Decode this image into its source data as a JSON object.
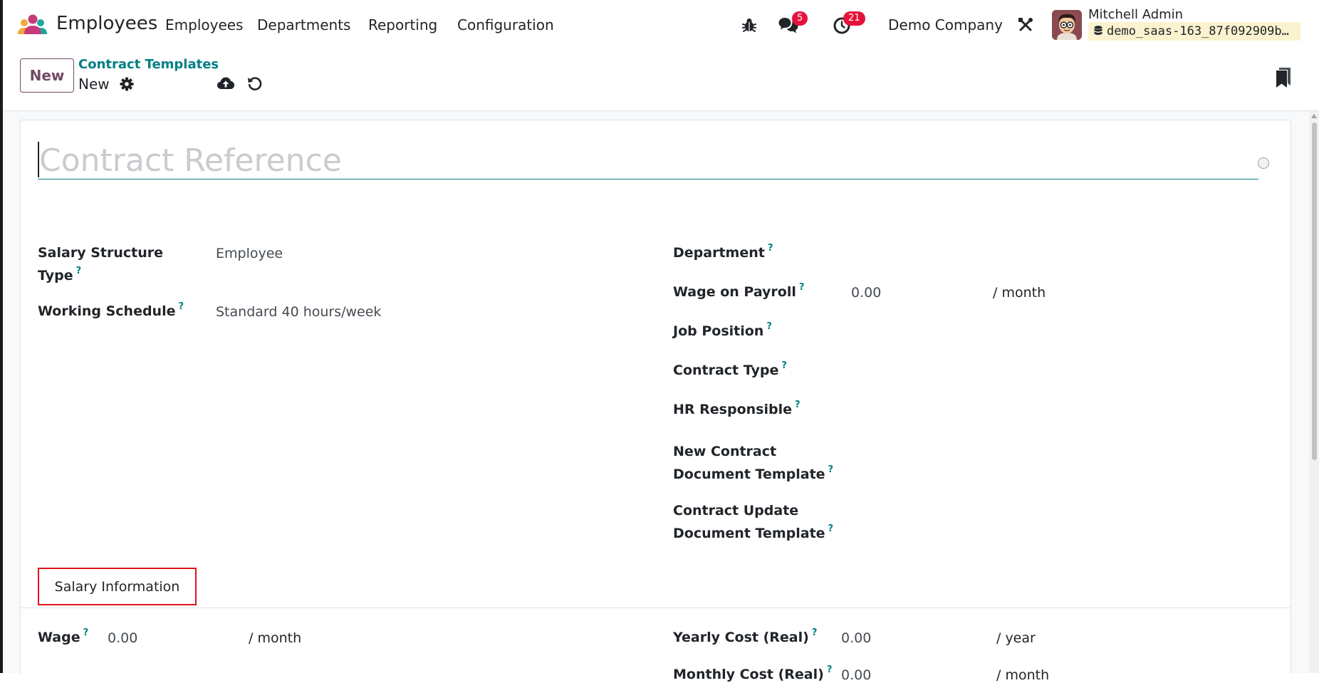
{
  "navbar": {
    "app_name": "Employees",
    "menus": [
      "Employees",
      "Departments",
      "Reporting",
      "Configuration"
    ],
    "messages_count": "5",
    "activities_count": "21",
    "company": "Demo Company",
    "user_name": "Mitchell Admin",
    "database": "demo_saas-163_87f092909b…"
  },
  "control_panel": {
    "new_button": "New",
    "breadcrumb_parent": "Contract Templates",
    "record_name": "New"
  },
  "form": {
    "title_placeholder": "Contract Reference",
    "left_fields": [
      {
        "label_line1": "Salary Structure",
        "label_line2": "Type",
        "value": "Employee"
      },
      {
        "label": "Working Schedule",
        "value": "Standard 40 hours/week"
      }
    ],
    "right_fields": {
      "department": "Department",
      "wage_on_payroll": "Wage on Payroll",
      "wage_on_payroll_value": "0.00",
      "wage_on_payroll_unit": "/ month",
      "job_position": "Job Position",
      "contract_type": "Contract Type",
      "hr_responsible": "HR Responsible",
      "new_contract_doc_line1": "New Contract",
      "new_contract_doc_line2": "Document Template",
      "contract_update_doc_line1": "Contract Update",
      "contract_update_doc_line2": "Document Template"
    },
    "help_marker": "?",
    "tab_label": "Salary Information",
    "salary": {
      "wage_label": "Wage",
      "wage_value": "0.00",
      "wage_unit": "/ month",
      "yearly_cost_label": "Yearly Cost (Real)",
      "yearly_cost_value": "0.00",
      "yearly_cost_unit": "/ year",
      "monthly_cost_label": "Monthly Cost (Real)",
      "monthly_cost_value": "0.00",
      "monthly_cost_unit": "/ month"
    }
  },
  "colors": {
    "brand": "#714b67",
    "link": "#017e84",
    "badge": "#e5133b",
    "tab_highlight": "#e0151d"
  }
}
